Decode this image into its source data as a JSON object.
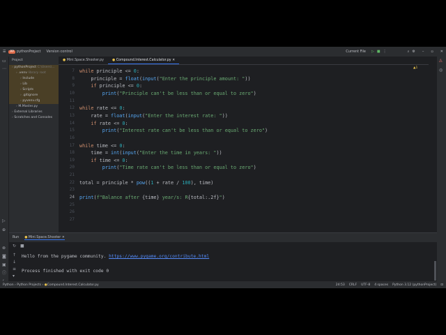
{
  "titlebar": {
    "project": "pythonProject",
    "project_badge": "PP",
    "vcs": "Version control",
    "run_config": "Current File"
  },
  "project_panel": {
    "title": "Project",
    "items": [
      {
        "label": "pythonProject",
        "extra": "C:\\Users\\...",
        "depth": 0,
        "highlight": true
      },
      {
        "label": ".venv",
        "extra": "library root",
        "depth": 1,
        "highlight": true
      },
      {
        "label": "Include",
        "depth": 2,
        "highlight": true
      },
      {
        "label": "Lib",
        "depth": 2,
        "highlight": true
      },
      {
        "label": "Scripts",
        "depth": 2,
        "highlight": true
      },
      {
        "label": ".gitignore",
        "depth": 2,
        "highlight": true
      },
      {
        "label": "pyvenv.cfg",
        "depth": 2,
        "highlight": true
      },
      {
        "label": "M.Master.py",
        "depth": 1,
        "highlight": false
      },
      {
        "label": "External Libraries",
        "depth": 0,
        "highlight": false
      },
      {
        "label": "Scratches and Consoles",
        "depth": 0,
        "highlight": false
      }
    ]
  },
  "editor": {
    "tabs": [
      {
        "label": "Mini.Space.Shooter.py",
        "active": false
      },
      {
        "label": "Compound.Interest.Calculator.py",
        "active": true
      }
    ],
    "inspection": "▲1",
    "lines": [
      {
        "n": "7",
        "html": "<span class='kw'>while</span> principle <= <span class='nm'>0</span>:"
      },
      {
        "n": "8",
        "html": "    principle = <span class='fn'>float</span>(<span class='fn'>input</span>(<span class='st'>\"Enter the principle amount: \"</span>))"
      },
      {
        "n": "9",
        "html": "    <span class='kw'>if</span> principle <= <span class='nm'>0</span>:"
      },
      {
        "n": "10",
        "html": "        <span class='fn'>print</span>(<span class='st'>\"Principle can't be less than or equal to zero\"</span>)"
      },
      {
        "n": "11",
        "html": ""
      },
      {
        "n": "12",
        "html": "<span class='kw'>while</span> rate <= <span class='nm'>0</span>:"
      },
      {
        "n": "13",
        "html": "    rate = <span class='fn'>float</span>(<span class='fn'>input</span>(<span class='st'>\"Enter the interest rate: \"</span>))"
      },
      {
        "n": "14",
        "html": "    <span class='kw'>if</span> rate <= <span class='nm'>0</span>:"
      },
      {
        "n": "15",
        "html": "        <span class='fn'>print</span>(<span class='st'>\"Interest rate can't be less than or equal to zero\"</span>)"
      },
      {
        "n": "16",
        "html": ""
      },
      {
        "n": "17",
        "html": "<span class='kw'>while</span> time <= <span class='nm'>0</span>:"
      },
      {
        "n": "18",
        "html": "    time = <span class='fn'>int</span>(<span class='fn'>input</span>(<span class='st'>\"Enter the time in years: \"</span>))"
      },
      {
        "n": "19",
        "html": "    <span class='kw'>if</span> time <= <span class='nm'>0</span>:"
      },
      {
        "n": "20",
        "html": "        <span class='fn'>print</span>(<span class='st'>\"Time rate can't be less than or equal to zero\"</span>)"
      },
      {
        "n": "21",
        "html": ""
      },
      {
        "n": "22",
        "html": "total = principle * <span class='fn'>pow</span>((<span class='nm'>1</span> + rate / <span class='nm'>100</span>), time)"
      },
      {
        "n": "23",
        "html": ""
      },
      {
        "n": "24",
        "html": "<span class='fn'>print</span>(<span class='st'>f\"Balance after </span>{time}<span class='st'> year/s: R</span>{total:.2f}<span class='st'>\"</span>)"
      },
      {
        "n": "25",
        "html": ""
      },
      {
        "n": "26",
        "html": ""
      },
      {
        "n": "27",
        "html": ""
      }
    ]
  },
  "run": {
    "label": "Run",
    "tab": "Mini.Space.Shooter",
    "output_text": "Hello from the pygame community. ",
    "output_link": "https://www.pygame.org/contribute.html",
    "output_exit": "Process finished with exit code 0"
  },
  "status": {
    "breadcrumbs": [
      "Python",
      "Python Projects",
      "Compound.Interest.Calculator.py"
    ],
    "position": "24:53",
    "line_sep": "CRLF",
    "encoding": "UTF-8",
    "indent": "4 spaces",
    "interpreter": "Python 3.12 (pythonProject)"
  }
}
